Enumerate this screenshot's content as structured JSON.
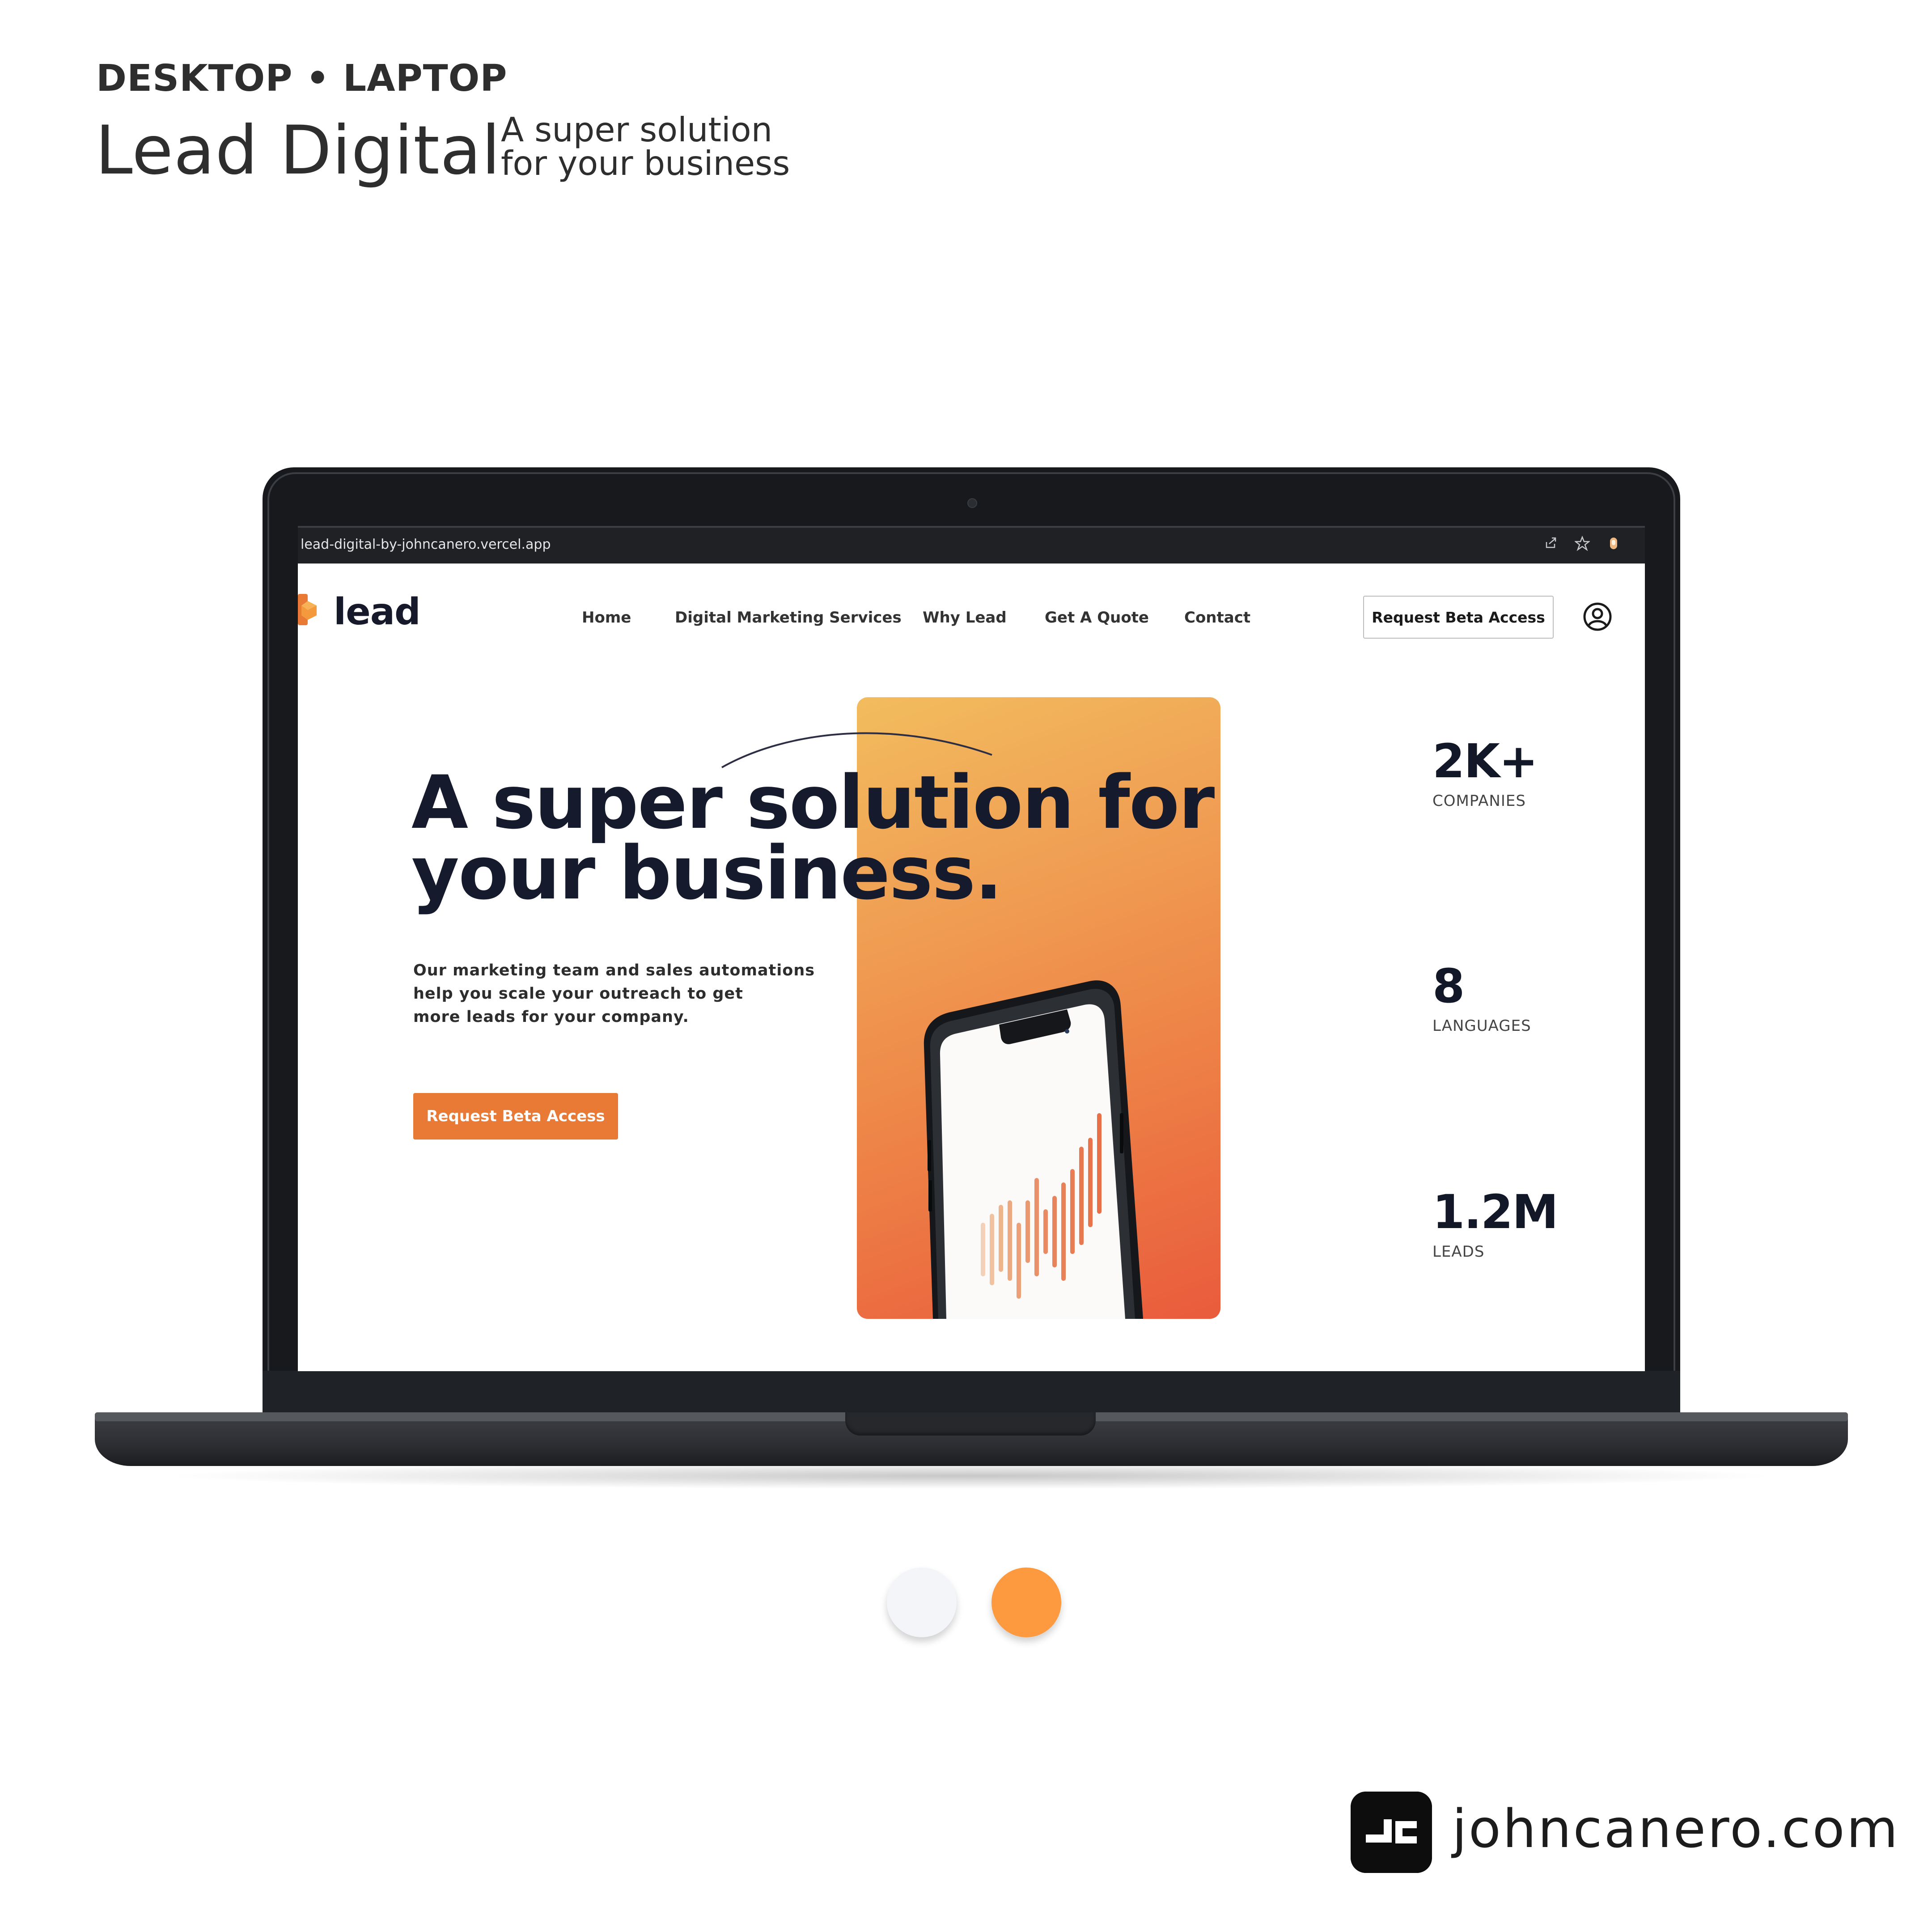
{
  "header": {
    "kicker": "DESKTOP • LAPTOP",
    "title": "Lead Digital",
    "tagline_line1": "A super solution",
    "tagline_line2": "for your business"
  },
  "browser": {
    "url": "lead-digital-by-johncanero.vercel.app"
  },
  "site": {
    "logo_text": "lead",
    "nav": {
      "home": "Home",
      "services": "Digital Marketing Services",
      "why": "Why Lead",
      "quote": "Get A Quote",
      "contact": "Contact"
    },
    "nav_button": "Request Beta Access",
    "hero": {
      "headline_line1": "A super solution for",
      "headline_line2": "your business.",
      "desc_line1": "Our marketing team and sales automations",
      "desc_line2": "help you scale your outreach to get",
      "desc_line3": "more leads for your company.",
      "cta": "Request Beta Access"
    },
    "stats": [
      {
        "value": "2K+",
        "label": "COMPANIES"
      },
      {
        "value": "8",
        "label": "LANGUAGES"
      },
      {
        "value": "1.2M",
        "label": "LEADS"
      }
    ]
  },
  "palette": {
    "light": "#f3f5f8",
    "accent": "#fd9a3f"
  },
  "footer": {
    "site": "johncanero.com"
  },
  "icons": [
    "share-icon",
    "star-icon",
    "extension-icon",
    "user-circle-icon",
    "moon-icon"
  ]
}
